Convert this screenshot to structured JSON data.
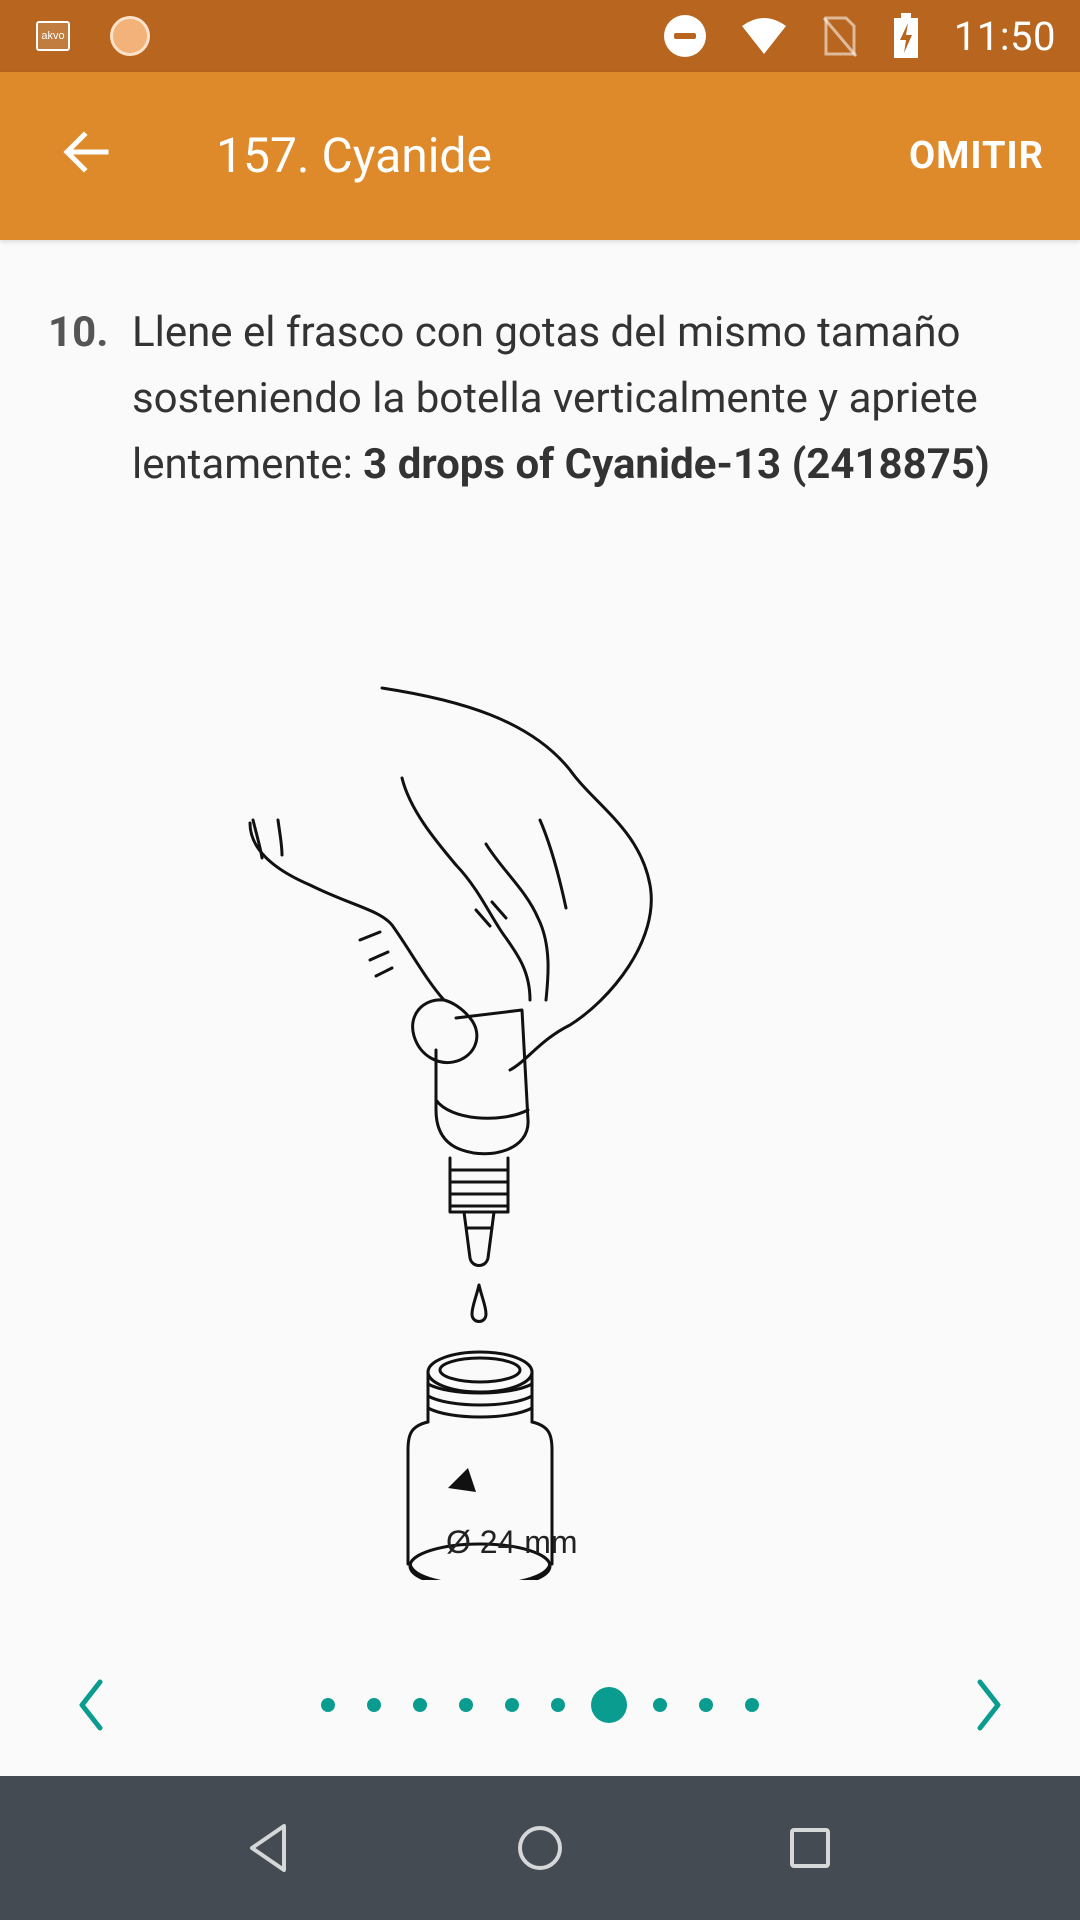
{
  "status_bar": {
    "app_icon_text": "akvo",
    "time": "11:50"
  },
  "app_bar": {
    "title": "157. Cyanide",
    "skip_label": "OMITIR"
  },
  "instruction": {
    "number": "10.",
    "text": "Llene el frasco con gotas del mismo tamaño sosteniendo la botella verticalmente y apriete lentamente: ",
    "bold_text": "3 drops of Cyanide-13 (2418875)"
  },
  "illustration": {
    "size_label": "Ø 24 mm"
  },
  "pager": {
    "total_pages": 10,
    "current_page": 7
  },
  "colors": {
    "status_bar": "#b7651f",
    "app_bar": "#de8a2b",
    "accent": "#0a9c8f",
    "nav_bar": "#444b52"
  }
}
